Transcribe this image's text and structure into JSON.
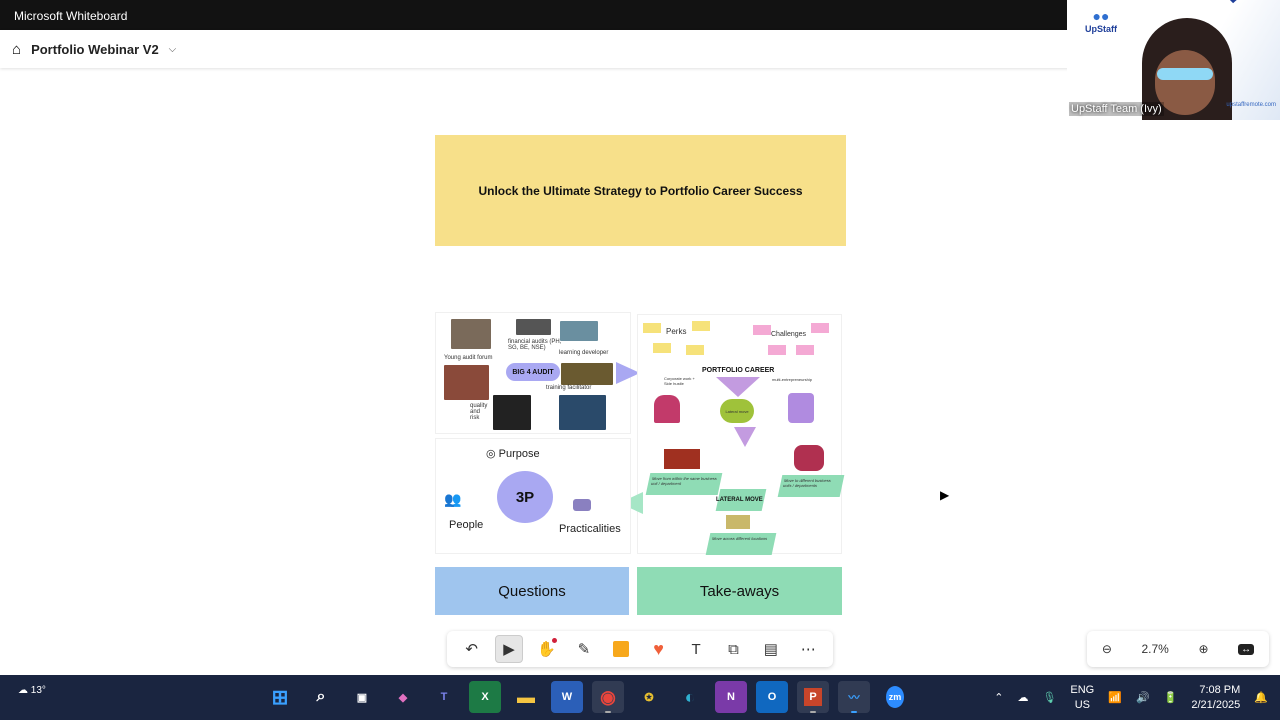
{
  "window": {
    "title": "Microsoft Whiteboard"
  },
  "appbar": {
    "board_title": "Portfolio Webinar V2"
  },
  "video": {
    "participant": "UpStaff Team (Ivy)",
    "logo": "UpStaff",
    "site": "upstaffremote.com"
  },
  "board": {
    "banner": "Unlock the Ultimate Strategy to Portfolio Career Success",
    "diagram": {
      "audit": {
        "center": "BIG 4 AUDIT",
        "labels": [
          "Young audit forum",
          "financial audits (PH, SG, BE, NSE)",
          "learning developer",
          "training facilitator",
          "quality and risk"
        ]
      },
      "career": {
        "perks": "Perks",
        "challenges": "Challenges",
        "title": "PORTFOLIO CAREER",
        "left": "Corporate work + Side hustle",
        "right": "multi-entrepreneurship",
        "circle": "Lateral move"
      },
      "lateral": {
        "title": "LATERAL MOVE",
        "notes": [
          "Move from within the same business unit / department",
          "Move to different business units / departments",
          "Move across different locations"
        ]
      },
      "threep": {
        "center": "3P",
        "purpose": "Purpose",
        "people": "People",
        "practicalities": "Practicalities"
      }
    },
    "questions": "Questions",
    "takeaways": "Take-aways",
    "colors": {
      "banner": "#f7e08a",
      "questions": "#9fc5ee",
      "takeaways": "#8fdcb5",
      "accent": "#a9a8f2"
    }
  },
  "toolbar": {
    "icons": [
      "undo-icon",
      "select-icon",
      "hand-icon",
      "pen-icon",
      "sticky-note-icon",
      "reaction-icon",
      "text-icon",
      "shapes-icon",
      "templates-icon",
      "more-icon"
    ]
  },
  "zoom": {
    "level": "2.7%"
  },
  "taskbar": {
    "weather": "13°",
    "lang": "ENG",
    "region": "US",
    "time": "7:08 PM",
    "date": "2/21/2025"
  }
}
